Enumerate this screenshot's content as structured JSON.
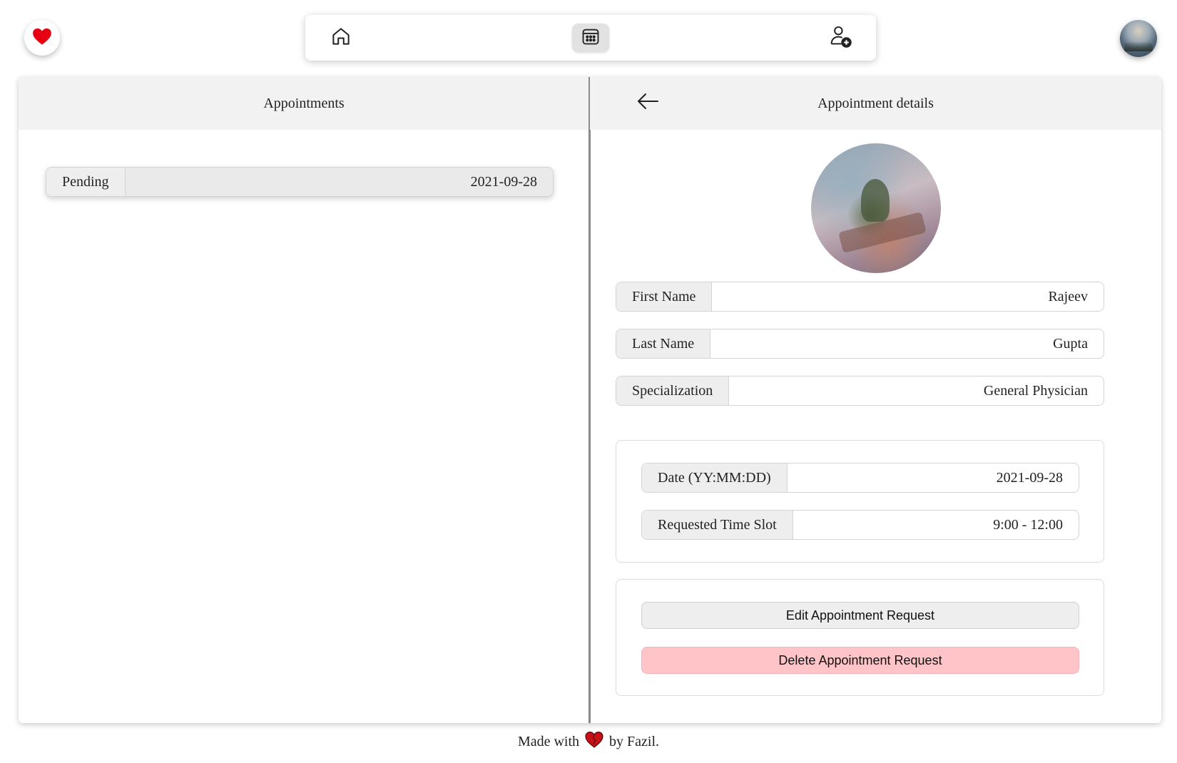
{
  "nav": {
    "logo_icon": "heart-icon",
    "items": [
      {
        "name": "home",
        "icon": "home-icon"
      },
      {
        "name": "appointments",
        "icon": "calendar-icon",
        "active": true
      },
      {
        "name": "add-user",
        "icon": "user-plus-icon"
      }
    ],
    "avatar_icon": "avatar"
  },
  "left_panel": {
    "title": "Appointments",
    "appointments": [
      {
        "status": "Pending",
        "date": "2021-09-28"
      }
    ]
  },
  "right_panel": {
    "title": "Appointment details",
    "back_icon": "arrow-left-icon",
    "fields": {
      "first_name_label": "First Name",
      "first_name": "Rajeev",
      "last_name_label": "Last Name",
      "last_name": "Gupta",
      "specialization_label": "Specialization",
      "specialization": "General Physician"
    },
    "schedule": {
      "date_label": "Date (YY:MM:DD)",
      "date": "2021-09-28",
      "slot_label": "Requested Time Slot",
      "slot": "9:00 - 12:00"
    },
    "actions": {
      "edit_label": "Edit Appointment Request",
      "delete_label": "Delete Appointment Request"
    }
  },
  "footer": {
    "prefix": "Made with",
    "suffix": "by Fazil."
  },
  "colors": {
    "accent_red": "#e60012",
    "delete_bg": "#ffc4c8",
    "header_bg": "#f2f2f2"
  }
}
